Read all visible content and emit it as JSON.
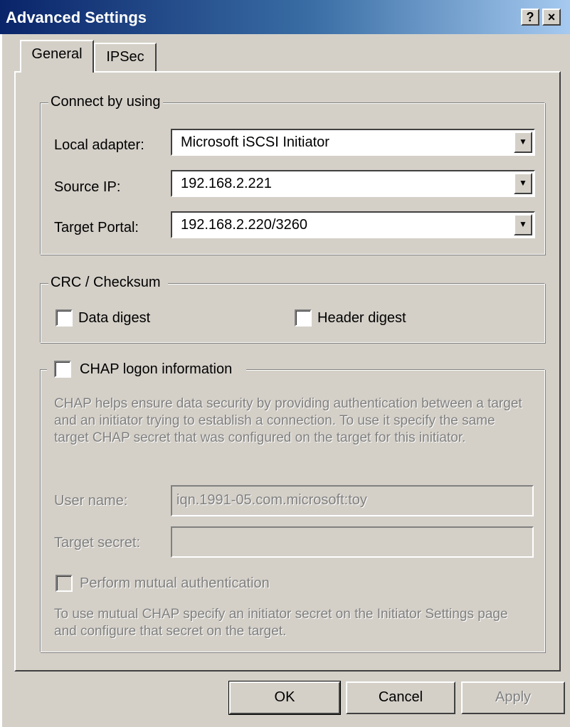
{
  "window": {
    "title": "Advanced Settings",
    "help_glyph": "?",
    "close_glyph": "×"
  },
  "tabs": [
    {
      "label": "General",
      "selected": true
    },
    {
      "label": "IPSec",
      "selected": false
    }
  ],
  "connect": {
    "legend": "Connect by using",
    "local_adapter_label": "Local adapter:",
    "local_adapter_value": "Microsoft iSCSI Initiator",
    "source_ip_label": "Source IP:",
    "source_ip_value": "192.168.2.221",
    "target_portal_label": "Target Portal:",
    "target_portal_value": "192.168.2.220/3260"
  },
  "crc": {
    "legend": "CRC / Checksum",
    "data_digest": "Data digest",
    "header_digest": "Header digest"
  },
  "chap": {
    "legend": "CHAP logon information",
    "description": "CHAP helps ensure data security by providing authentication between a target and an initiator trying to establish a connection. To use it specify the same target CHAP secret that was configured on the target for this initiator.",
    "user_name_label": "User name:",
    "user_name_value": "iqn.1991-05.com.microsoft:toy",
    "target_secret_label": "Target secret:",
    "target_secret_value": "",
    "mutual_label": "Perform mutual authentication",
    "mutual_description": "To use mutual CHAP specify an initiator secret on the Initiator Settings page and configure that secret on the target."
  },
  "buttons": {
    "ok": "OK",
    "cancel": "Cancel",
    "apply": "Apply"
  },
  "icons": {
    "dropdown": "▼"
  }
}
